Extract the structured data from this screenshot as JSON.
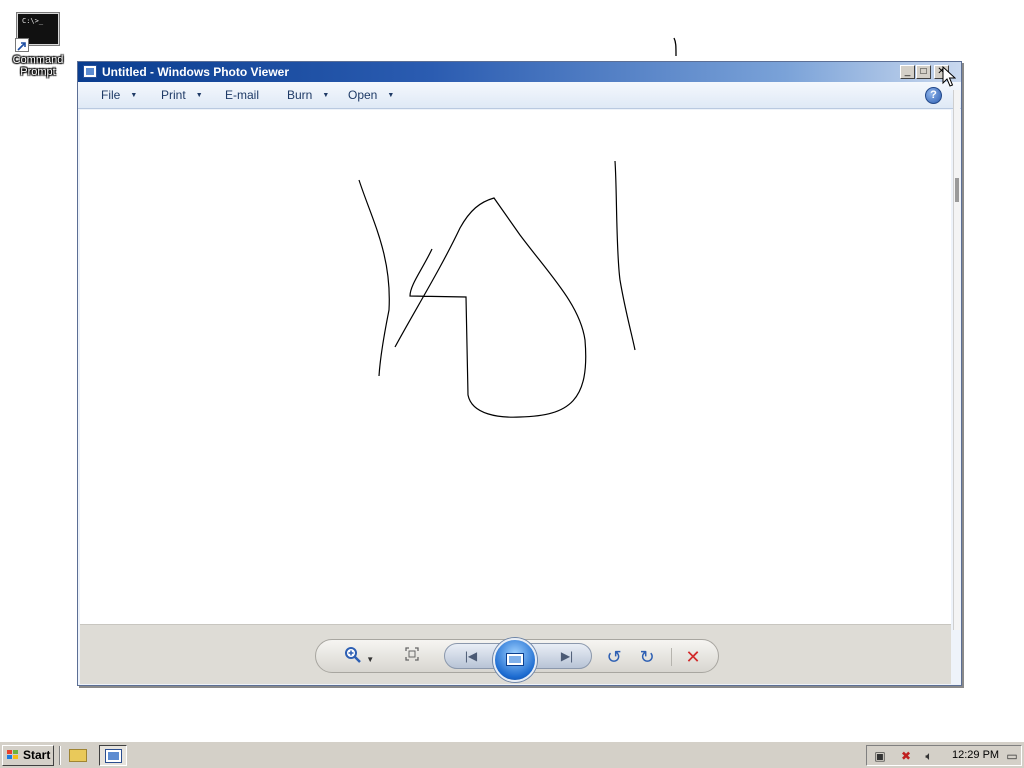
{
  "desktop": {
    "icons": [
      {
        "label": "Command Prompt",
        "glyph": "C:\\>_"
      }
    ]
  },
  "window": {
    "title": "Untitled - Windows Photo Viewer",
    "controls": {
      "minimize": "_",
      "maximize": "□",
      "close": "✕"
    },
    "menu": [
      {
        "label": "File",
        "has_dropdown": true
      },
      {
        "label": "Print",
        "has_dropdown": true
      },
      {
        "label": "E-mail",
        "has_dropdown": false
      },
      {
        "label": "Burn",
        "has_dropdown": true
      },
      {
        "label": "Open",
        "has_dropdown": true
      }
    ],
    "help_label": "?",
    "image": {
      "description_icon": "drawing-canvas"
    },
    "controlbar": {
      "zoom_icon": "zoom-icon",
      "fit_icon": "actual-size-icon",
      "prev_icon": "previous-icon",
      "slideshow_icon": "slideshow-icon",
      "next_icon": "next-icon",
      "rotate_left_icon": "rotate-counterclockwise-icon",
      "rotate_right_icon": "rotate-clockwise-icon",
      "delete_icon": "delete-icon"
    }
  },
  "taskbar": {
    "start_label": "Start",
    "quick_launch": [
      "explorer-icon",
      "photo-viewer-icon"
    ],
    "tray": {
      "clock": "12:29 PM",
      "icons": [
        "network-icon",
        "network-error-icon",
        "volume-icon",
        "show-desktop-icon"
      ]
    }
  },
  "colors": {
    "titlebar_start": "#0a3d8f",
    "accent": "#2d5fb3",
    "delete": "#d22a2a",
    "taskbar": "#d4d0c8"
  }
}
